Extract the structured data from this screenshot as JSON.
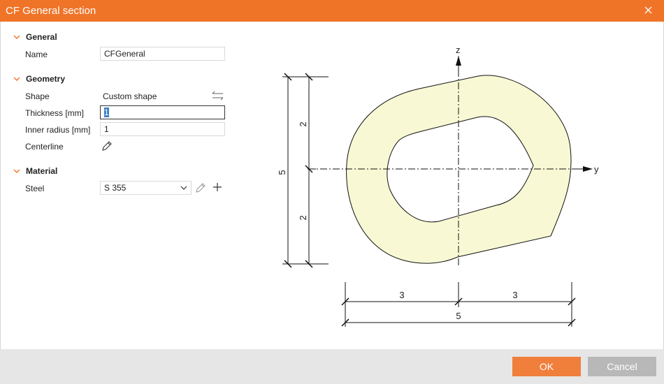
{
  "window": {
    "title": "CF General section"
  },
  "sections": {
    "general": {
      "label": "General",
      "name_label": "Name",
      "name_value": "CFGeneral"
    },
    "geometry": {
      "label": "Geometry",
      "shape_label": "Shape",
      "shape_value": "Custom shape",
      "thickness_label": "Thickness [mm]",
      "thickness_value": "1",
      "inner_radius_label": "Inner radius [mm]",
      "inner_radius_value": "1",
      "centerline_label": "Centerline"
    },
    "material": {
      "label": "Material",
      "steel_label": "Steel",
      "steel_value": "S 355"
    }
  },
  "diagram": {
    "axis_z": "z",
    "axis_y": "y",
    "dim_total_height": "5",
    "dim_upper_height": "2",
    "dim_lower_height": "2",
    "dim_left_width": "3",
    "dim_right_width": "3",
    "dim_total_width": "5",
    "fill_color": "#f8f8d4"
  },
  "footer": {
    "ok_label": "OK",
    "cancel_label": "Cancel"
  },
  "colors": {
    "accent": "#f07428",
    "ok_button": "#f07f3c",
    "cancel_button": "#b8b8b8"
  }
}
